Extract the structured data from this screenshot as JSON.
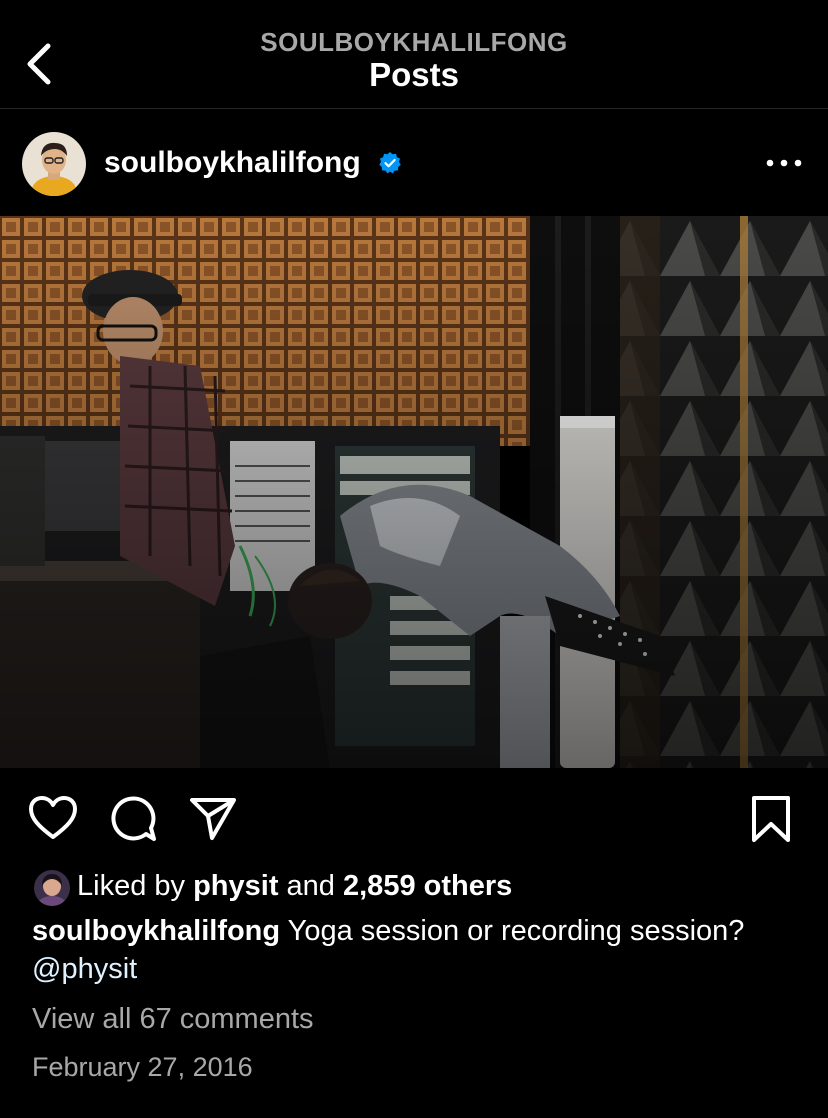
{
  "header": {
    "account": "SOULBOYKHALILFONG",
    "title": "Posts",
    "back_icon": "chevron-left-icon"
  },
  "post": {
    "username": "soulboykhalilfong",
    "verified_icon": "verified-badge-icon",
    "more_icon": "more-horizontal-icon",
    "photo_description_icon": "studio-photo",
    "actions": {
      "like_icon": "heart-icon",
      "comment_icon": "comment-icon",
      "share_icon": "send-icon",
      "save_icon": "bookmark-icon"
    },
    "likes": {
      "prefix": "Liked by",
      "liker": "physit",
      "and": "and",
      "others": "2,859 others"
    },
    "caption": {
      "username": "soulboykhalilfong",
      "text": "Yoga session or recording session?",
      "mention": "@physit"
    },
    "comments_link": "View all 67 comments",
    "date": "February 27, 2016"
  },
  "colors": {
    "background": "#000000",
    "primary_text": "#ffffff",
    "secondary_text": "#a8a8a8",
    "verified_blue": "#0095f6"
  }
}
